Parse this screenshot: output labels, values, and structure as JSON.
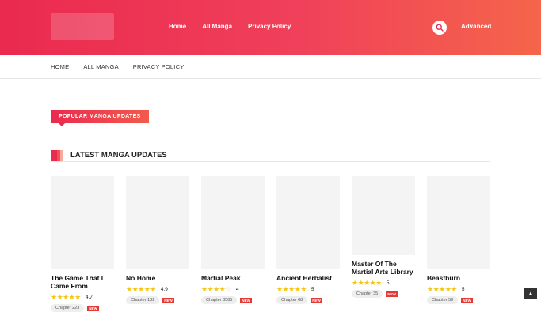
{
  "header": {
    "nav": [
      "Home",
      "All Manga",
      "Privacy Policy"
    ],
    "advanced_label": "Advanced"
  },
  "subnav": [
    "HOME",
    "ALL MANGA",
    "PRIVACY POLICY"
  ],
  "popular_heading": "POPULAR MANGA UPDATES",
  "latest_heading": "LATEST MANGA UPDATES",
  "cards": [
    {
      "title": "The Game That I Came From",
      "rating": "4.7",
      "stars": 4.7,
      "chapter": "Chapter 223",
      "badge": "NEW"
    },
    {
      "title": "No Home",
      "rating": "4.9",
      "stars": 4.9,
      "chapter": "Chapter 132",
      "badge": "NEW"
    },
    {
      "title": "Martial Peak",
      "rating": "4",
      "stars": 4,
      "chapter": "Chapter 3585",
      "badge": "NEW"
    },
    {
      "title": "Ancient Herbalist",
      "rating": "5",
      "stars": 5,
      "chapter": "Chapter 68",
      "badge": "NEW"
    },
    {
      "title": "Master Of The Martial Arts Library",
      "rating": "5",
      "stars": 5,
      "chapter": "Chapter 35",
      "badge": "NEW"
    },
    {
      "title": "Beastburn",
      "rating": "5",
      "stars": 5,
      "chapter": "Chapter 59",
      "badge": "NEW"
    }
  ],
  "colors": {
    "accent": "#ea2a4f",
    "accent_end": "#f5654a",
    "star": "#f5c518"
  }
}
